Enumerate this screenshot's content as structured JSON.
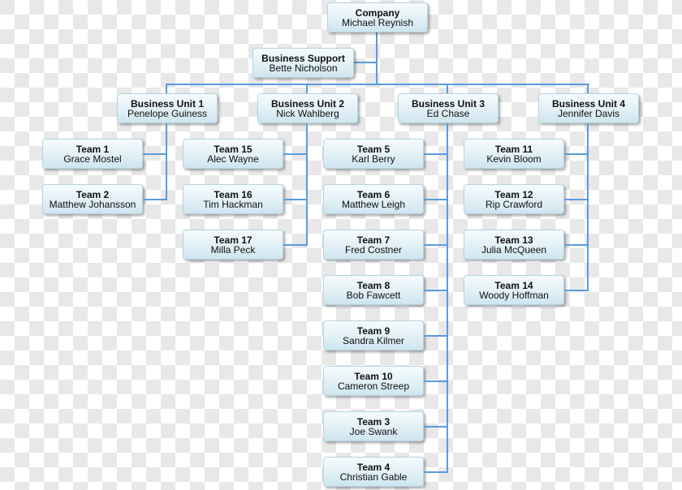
{
  "chart": {
    "company": {
      "title": "Company",
      "person": "Michael Reynish"
    },
    "support": {
      "title": "Business Support",
      "person": "Bette Nicholson"
    },
    "units": [
      {
        "title": "Business Unit 1",
        "person": "Penelope Guiness",
        "teams": [
          {
            "title": "Team 1",
            "person": "Grace Mostel"
          },
          {
            "title": "Team 2",
            "person": "Matthew Johansson"
          }
        ]
      },
      {
        "title": "Business Unit 2",
        "person": "Nick Wahlberg",
        "teams": [
          {
            "title": "Team 15",
            "person": "Alec Wayne"
          },
          {
            "title": "Team 16",
            "person": "Tim Hackman"
          },
          {
            "title": "Team 17",
            "person": "Milla Peck"
          }
        ]
      },
      {
        "title": "Business Unit 3",
        "person": "Ed Chase",
        "teams": [
          {
            "title": "Team 5",
            "person": "Karl Berry"
          },
          {
            "title": "Team 6",
            "person": "Matthew Leigh"
          },
          {
            "title": "Team 7",
            "person": "Fred Costner"
          },
          {
            "title": "Team 8",
            "person": "Bob Fawcett"
          },
          {
            "title": "Team 9",
            "person": "Sandra Kilmer"
          },
          {
            "title": "Team 10",
            "person": "Cameron Streep"
          },
          {
            "title": "Team 3",
            "person": "Joe Swank"
          },
          {
            "title": "Team 4",
            "person": "Christian Gable"
          }
        ]
      },
      {
        "title": "Business Unit 4",
        "person": "Jennifer Davis",
        "teams": [
          {
            "title": "Team 11",
            "person": "Kevin Bloom"
          },
          {
            "title": "Team 12",
            "person": "Rip Crawford"
          },
          {
            "title": "Team 13",
            "person": "Julia McQueen"
          },
          {
            "title": "Team 14",
            "person": "Woody Hoffman"
          }
        ]
      }
    ]
  }
}
